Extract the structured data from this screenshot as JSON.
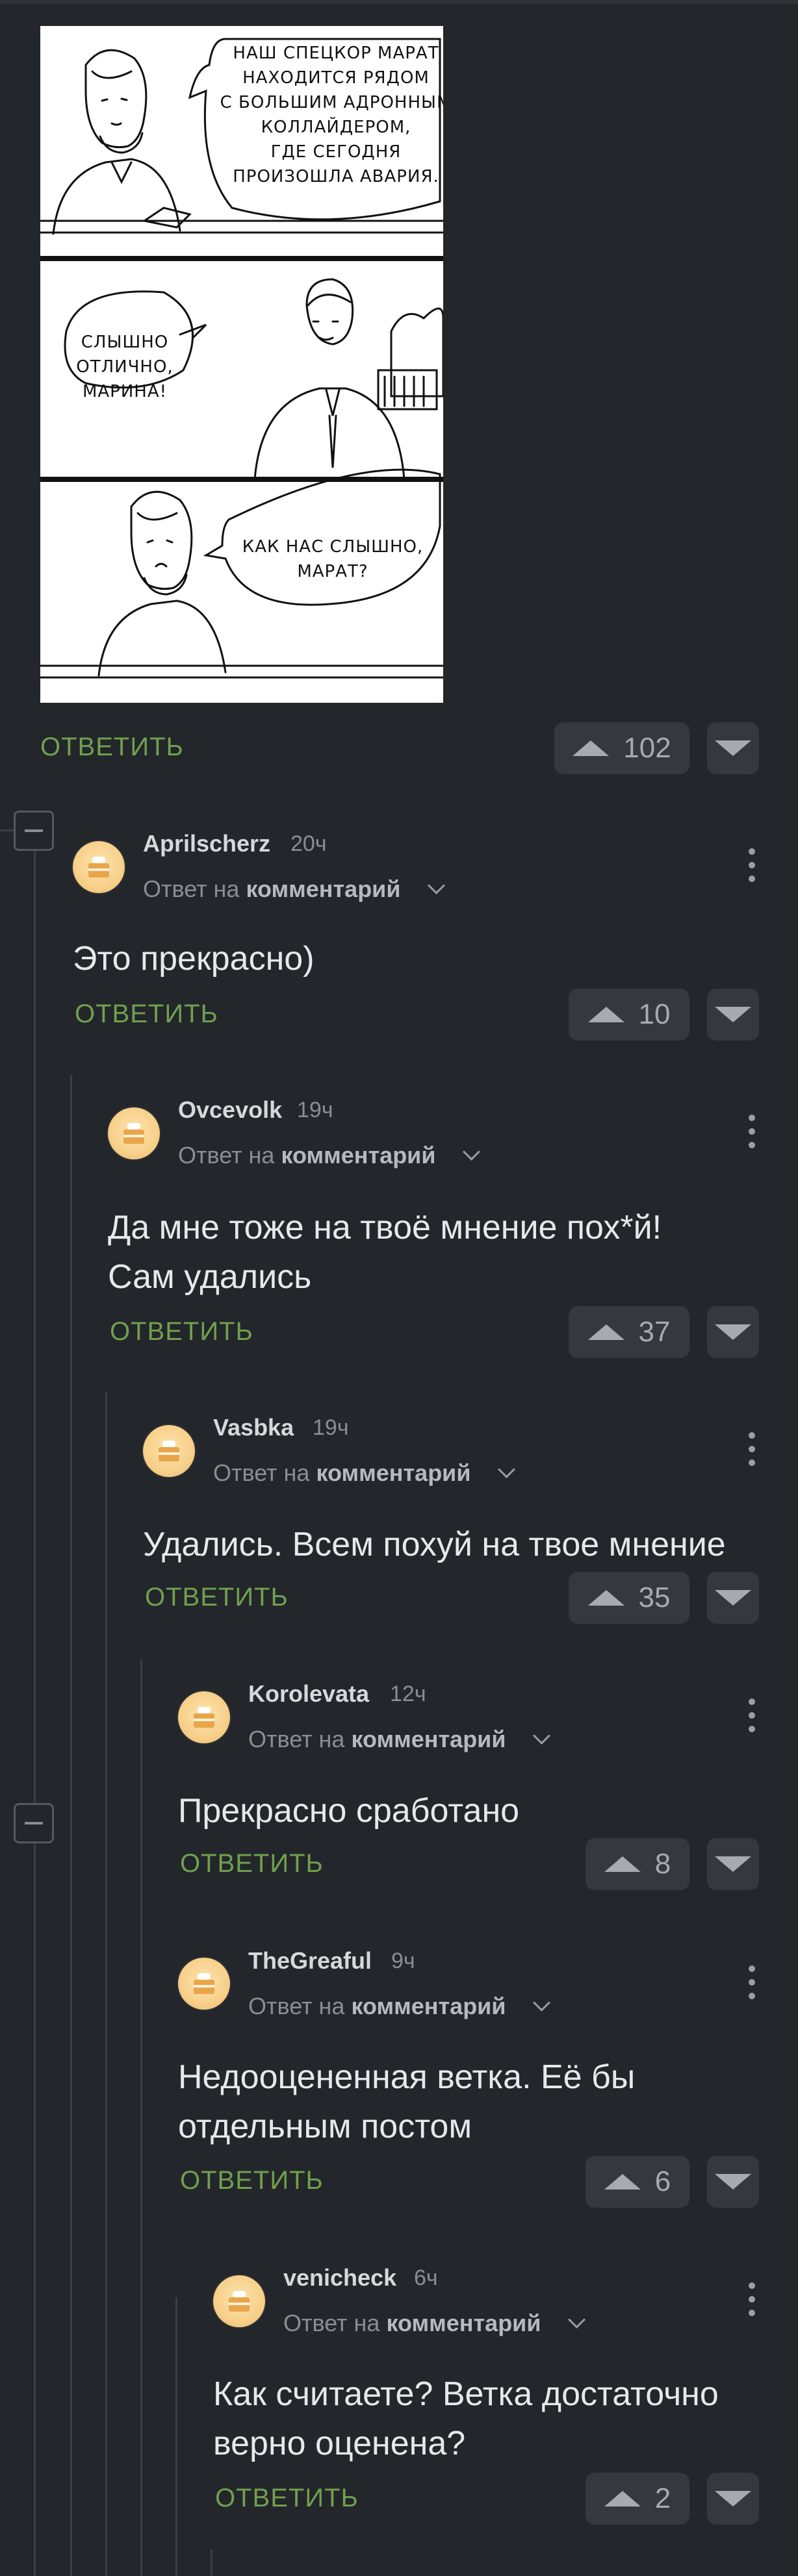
{
  "comic": {
    "panel1_text": [
      "НАШ СПЕЦКОР МАРАТ",
      "НАХОДИТСЯ РЯДОМ",
      "С БОЛЬШИМ АДРОННЫМ",
      "КОЛЛАЙДЕРОМ,",
      "ГДЕ СЕГОДНЯ",
      "ПРОИЗОШЛА АВАРИЯ."
    ],
    "panel2_text": [
      "СЛЫШНО",
      "ОТЛИЧНО,",
      "МАРИНА!"
    ],
    "panel3_text": [
      "КАК НАС СЛЫШНО,",
      "МАРАТ?"
    ]
  },
  "post_actions": {
    "reply_label": "ОТВЕТИТЬ",
    "upvotes": "102"
  },
  "comments": [
    {
      "username": "Aprilscherz",
      "time": "20ч",
      "reply_prefix": "Ответ на",
      "reply_target": "комментарий",
      "text": [
        "Это прекрасно)"
      ],
      "reply_label": "ОТВЕТИТЬ",
      "upvotes": "10"
    },
    {
      "username": "Ovcevolk",
      "time": "19ч",
      "reply_prefix": "Ответ на",
      "reply_target": "комментарий",
      "text": [
        "Да мне тоже на твоё мнение пох*й!",
        "Сам удались"
      ],
      "reply_label": "ОТВЕТИТЬ",
      "upvotes": "37"
    },
    {
      "username": "Vasbka",
      "time": "19ч",
      "reply_prefix": "Ответ на",
      "reply_target": "комментарий",
      "text": [
        "Удались. Всем похуй на твое мнение"
      ],
      "reply_label": "ОТВЕТИТЬ",
      "upvotes": "35"
    },
    {
      "username": "Korolevata",
      "time": "12ч",
      "reply_prefix": "Ответ на",
      "reply_target": "комментарий",
      "text": [
        "Прекрасно сработано"
      ],
      "reply_label": "ОТВЕТИТЬ",
      "upvotes": "8"
    },
    {
      "username": "TheGreaful",
      "time": "9ч",
      "reply_prefix": "Ответ на",
      "reply_target": "комментарий",
      "text": [
        "Недооцененная ветка. Её бы",
        "отдельным постом"
      ],
      "reply_label": "ОТВЕТИТЬ",
      "upvotes": "6"
    },
    {
      "username": "venicheck",
      "time": "6ч",
      "reply_prefix": "Ответ на",
      "reply_target": "комментарий",
      "text": [
        "Как считаете? Ветка достаточно",
        "верно оценена?"
      ],
      "reply_label": "ОТВЕТИТЬ",
      "upvotes": "2"
    }
  ],
  "colors": {
    "background": "#23262a",
    "reply": "#6fa04f",
    "vote_bg": "#35393e"
  }
}
